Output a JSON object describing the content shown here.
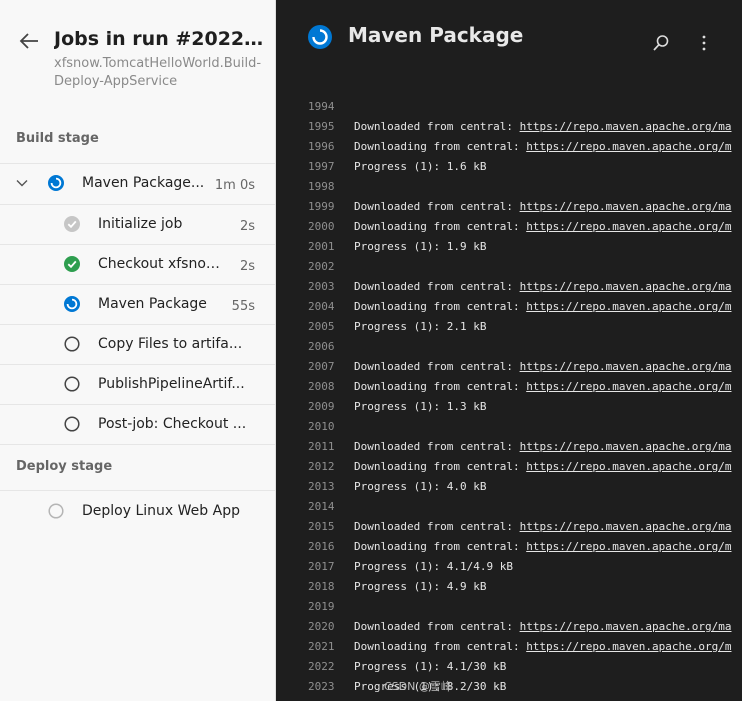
{
  "left": {
    "title": "Jobs in run #20220...",
    "subtitle": "xfsnow.TomcatHelloWorld.Build-Deploy-AppService",
    "build_stage_label": "Build stage",
    "deploy_stage_label": "Deploy stage",
    "job": {
      "label": "Maven Package...",
      "duration": "1m 0s"
    },
    "steps": [
      {
        "label": "Initialize job",
        "duration": "2s",
        "status": "skipped"
      },
      {
        "label": "Checkout xfsnow...",
        "duration": "2s",
        "status": "success"
      },
      {
        "label": "Maven Package",
        "duration": "55s",
        "status": "running"
      },
      {
        "label": "Copy Files to artifa...",
        "duration": "",
        "status": "pending"
      },
      {
        "label": "PublishPipelineArtif...",
        "duration": "",
        "status": "pending"
      },
      {
        "label": "Post-job: Checkout ...",
        "duration": "",
        "status": "pending"
      }
    ],
    "deploy_job": {
      "label": "Deploy Linux Web App"
    }
  },
  "right": {
    "title": "Maven Package",
    "log": [
      {
        "n": "1994",
        "prefix": "",
        "url": ""
      },
      {
        "n": "1995",
        "prefix": "Downloaded from central: ",
        "url": "https://repo.maven.apache.org/ma"
      },
      {
        "n": "1996",
        "prefix": "Downloading from central: ",
        "url": "https://repo.maven.apache.org/m"
      },
      {
        "n": "1997",
        "prefix": "Progress (1): 1.6 kB",
        "url": ""
      },
      {
        "n": "1998",
        "prefix": "",
        "url": ""
      },
      {
        "n": "1999",
        "prefix": "Downloaded from central: ",
        "url": "https://repo.maven.apache.org/ma"
      },
      {
        "n": "2000",
        "prefix": "Downloading from central: ",
        "url": "https://repo.maven.apache.org/m"
      },
      {
        "n": "2001",
        "prefix": "Progress (1): 1.9 kB",
        "url": ""
      },
      {
        "n": "2002",
        "prefix": "",
        "url": ""
      },
      {
        "n": "2003",
        "prefix": "Downloaded from central: ",
        "url": "https://repo.maven.apache.org/ma"
      },
      {
        "n": "2004",
        "prefix": "Downloading from central: ",
        "url": "https://repo.maven.apache.org/m"
      },
      {
        "n": "2005",
        "prefix": "Progress (1): 2.1 kB",
        "url": ""
      },
      {
        "n": "2006",
        "prefix": "",
        "url": ""
      },
      {
        "n": "2007",
        "prefix": "Downloaded from central: ",
        "url": "https://repo.maven.apache.org/ma"
      },
      {
        "n": "2008",
        "prefix": "Downloading from central: ",
        "url": "https://repo.maven.apache.org/m"
      },
      {
        "n": "2009",
        "prefix": "Progress (1): 1.3 kB",
        "url": ""
      },
      {
        "n": "2010",
        "prefix": "",
        "url": ""
      },
      {
        "n": "2011",
        "prefix": "Downloaded from central: ",
        "url": "https://repo.maven.apache.org/ma"
      },
      {
        "n": "2012",
        "prefix": "Downloading from central: ",
        "url": "https://repo.maven.apache.org/m"
      },
      {
        "n": "2013",
        "prefix": "Progress (1): 4.0 kB",
        "url": ""
      },
      {
        "n": "2014",
        "prefix": "",
        "url": ""
      },
      {
        "n": "2015",
        "prefix": "Downloaded from central: ",
        "url": "https://repo.maven.apache.org/ma"
      },
      {
        "n": "2016",
        "prefix": "Downloading from central: ",
        "url": "https://repo.maven.apache.org/m"
      },
      {
        "n": "2017",
        "prefix": "Progress (1): 4.1/4.9 kB",
        "url": ""
      },
      {
        "n": "2018",
        "prefix": "Progress (1): 4.9 kB",
        "url": ""
      },
      {
        "n": "2019",
        "prefix": "",
        "url": ""
      },
      {
        "n": "2020",
        "prefix": "Downloaded from central: ",
        "url": "https://repo.maven.apache.org/ma"
      },
      {
        "n": "2021",
        "prefix": "Downloading from central: ",
        "url": "https://repo.maven.apache.org/m"
      },
      {
        "n": "2022",
        "prefix": "Progress (1): 4.1/30 kB",
        "url": ""
      },
      {
        "n": "2023",
        "prefix": "Progress (1): 8.2/30 kB",
        "url": ""
      }
    ]
  },
  "watermark": "CSDN @雪峰",
  "colors": {
    "running": "#0078d4",
    "success": "#2e9e4f",
    "skipped": "#bdbdbd",
    "pending": "#555555"
  }
}
